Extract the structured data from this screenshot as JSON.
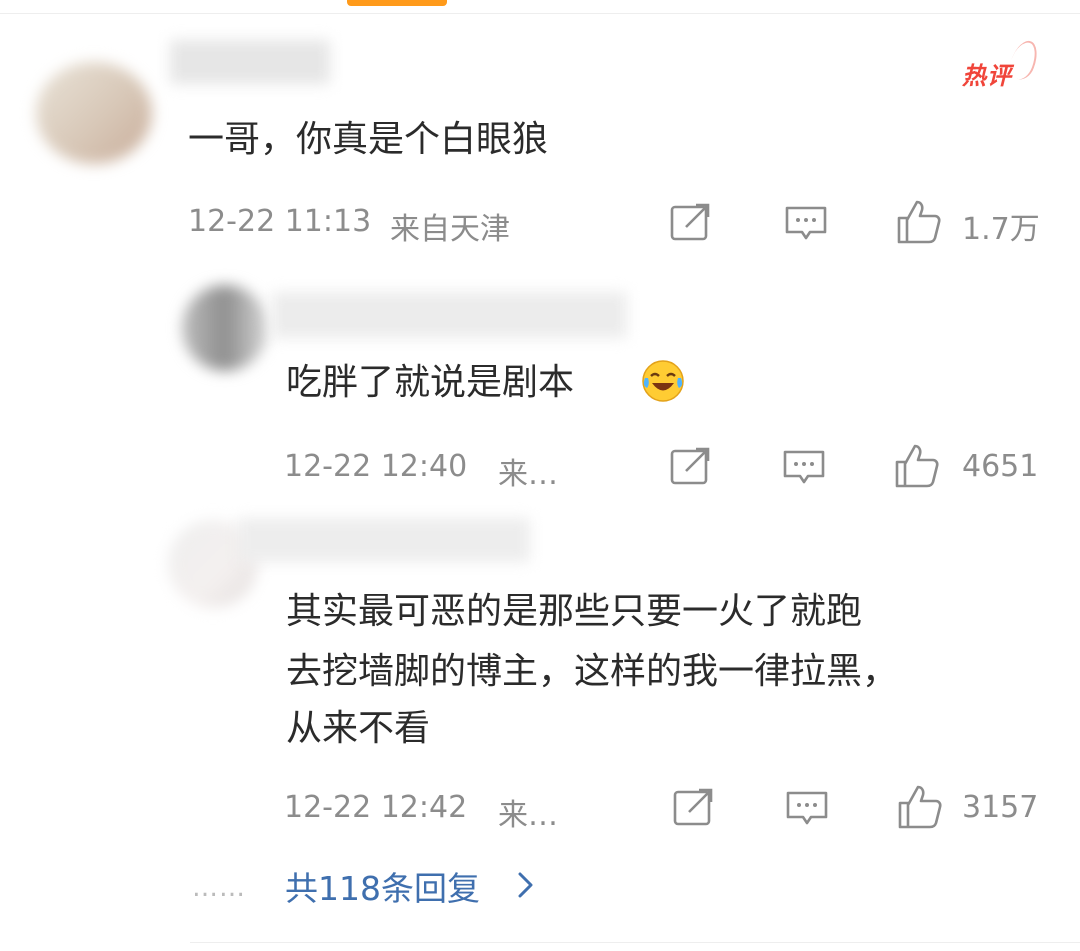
{
  "comments": [
    {
      "text": "一哥，你真是个白眼狼",
      "time": "12-22 11:13",
      "location": "来自天津",
      "likes": "1.7万",
      "badge": "热评"
    },
    {
      "text": "吃胖了就说是剧本",
      "time": "12-22 12:40",
      "location": "来…",
      "likes": "4651",
      "emoji": "laugh-cry"
    },
    {
      "text_lines": [
        "其实最可恶的是那些只要一火了就跑",
        "去挖墙脚的博主，这样的我一律拉黑，",
        "从来不看"
      ],
      "time": "12-22 12:42",
      "location": "来…",
      "likes": "3157"
    }
  ],
  "replies": {
    "dots": "……",
    "label": "共118条回复"
  },
  "colors": {
    "accent_link": "#3f6fae",
    "hot_badge": "#f0453a",
    "meta_gray": "#8c8c8c"
  },
  "icons": [
    "share-icon",
    "comment-icon",
    "like-icon",
    "chevron-right-icon"
  ]
}
